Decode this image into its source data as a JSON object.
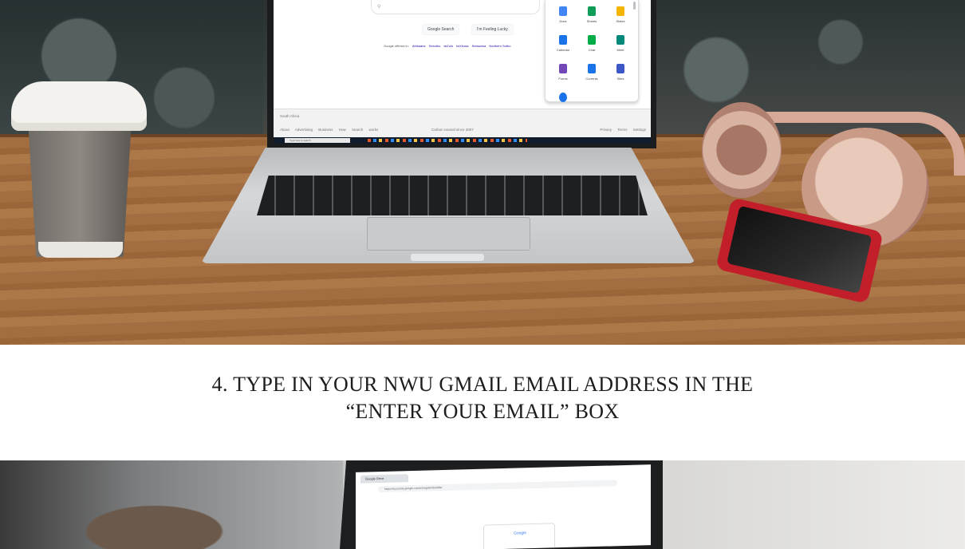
{
  "caption": {
    "line1": "4. TYPE IN YOUR NWU GMAIL EMAIL ADDRESS IN THE",
    "line2": "“ENTER YOUR EMAIL” BOX"
  },
  "top_screen": {
    "search_icon": "search-icon",
    "google_search_label": "Google Search",
    "lucky_label": "I'm Feeling Lucky",
    "offered_in_label": "Google offered in:",
    "languages": [
      "Afrikaans",
      "Sesotho",
      "isiZulu",
      "IsiXhosa",
      "Setswana",
      "Northern Sotho"
    ],
    "apps": [
      {
        "label": "Docs",
        "color": "#4285f4"
      },
      {
        "label": "Sheets",
        "color": "#0f9d58"
      },
      {
        "label": "Slides",
        "color": "#f4b400"
      },
      {
        "label": "Calendar",
        "color": "#1a73e8"
      },
      {
        "label": "Chat",
        "color": "#00ac47"
      },
      {
        "label": "Meet",
        "color": "#00897b"
      },
      {
        "label": "Forms",
        "color": "#7248b9"
      },
      {
        "label": "Currents",
        "color": "#1a73e8"
      },
      {
        "label": "Sites",
        "color": "#3c57c6"
      }
    ],
    "footer": {
      "country": "South Africa",
      "links_left": "About Advertising Business How Search works",
      "carbon": "Carbon neutral since 2007",
      "links_right": "Privacy Terms Settings"
    },
    "taskbar_search": "Type here to search"
  },
  "bottom_screen": {
    "tab_label": "Google Drive",
    "url": "https://accounts.google.com/v3/signin/identifier",
    "card_logo": "Google"
  }
}
